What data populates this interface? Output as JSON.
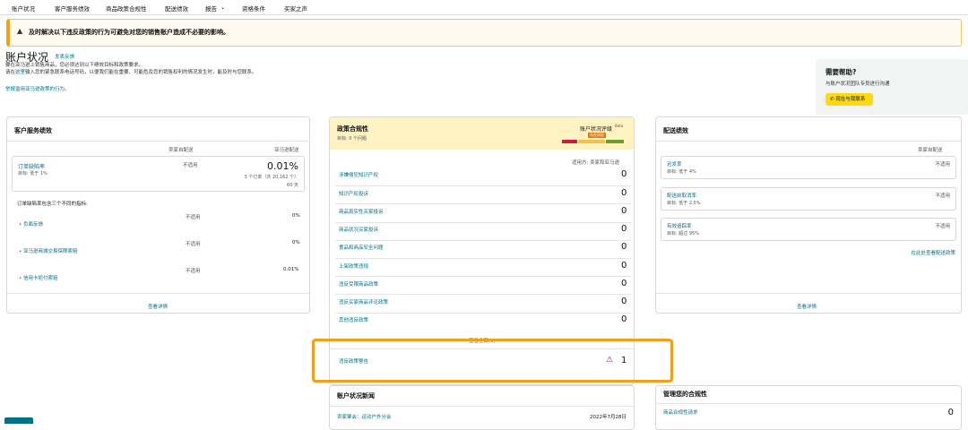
{
  "nav": {
    "items": [
      "账户状况",
      "客户服务绩效",
      "商品政策合规性",
      "配送绩效",
      "报告",
      "资格条件",
      "买家之声"
    ],
    "report_arrow": "⌄"
  },
  "banner": {
    "text": "及时解决以下违反政策的行为可避免对您的销售账户造成不必要的影响。"
  },
  "header": {
    "title": "账户状况",
    "feedback": "发表反馈",
    "intro_line1": "要在亚马逊上销售商品，您必须达到以下绩效目标和政策要求。",
    "intro_line2_pre": "请在",
    "intro_line2_link": "这里",
    "intro_line2_post": "输入您的紧急联系电话号码，以便我们能在重要、可能危及您的销售权利的情况发生时，能及时与您联系。",
    "policy_link": "举报滥用亚马逊政策的行为。"
  },
  "help": {
    "title": "需要帮助?",
    "subtitle": "与账户状况团队专员进行沟通",
    "button": "现在与我联系"
  },
  "customer_service": {
    "title": "客户服务绩效",
    "col1": "卖家自配送",
    "col2": "亚马逊配送",
    "odr_label": "订单缺陷率",
    "odr_target": "目标: 低于 1%",
    "odr_seller": "不适用",
    "odr_value": "0.01%",
    "odr_detail1": "3 个订单（共 20,162 个）",
    "odr_detail2": "60 天",
    "metrics_intro": "订单缺陷率包含三个不同的指标:",
    "metrics": [
      {
        "label": "负面反馈",
        "seller": "不适用",
        "fba": "0%"
      },
      {
        "label": "亚马逊商城交易保障索赔",
        "seller": "不适用",
        "fba": "0%"
      },
      {
        "label": "信用卡拒付索赔",
        "seller": "不适用",
        "fba": "0.01%"
      }
    ],
    "details": "查看详情"
  },
  "policy": {
    "title": "政策合规性",
    "target": "目标: 0 个问题",
    "status_label": "账户状况评级",
    "status_new": "Beta",
    "status_badge": "存在风险",
    "applies": "适用方: 卖家和亚马逊",
    "rows": [
      {
        "label": "涉嫌侵犯知识产权",
        "value": "0"
      },
      {
        "label": "知识产权投诉",
        "value": "0"
      },
      {
        "label": "商品真实性买家投诉",
        "value": "0"
      },
      {
        "label": "商品状况买家投诉",
        "value": "0"
      },
      {
        "label": "食品和商品安全问题",
        "value": "0"
      },
      {
        "label": "上架政策违规",
        "value": "0"
      },
      {
        "label": "违反受限商品政策",
        "value": "0"
      },
      {
        "label": "违反买家商品评论政策",
        "value": "0"
      },
      {
        "label": "其他违反政策",
        "value": "0"
      }
    ],
    "view_all": "查看全部(0)",
    "warning_label": "违反政策警告",
    "warning_value": "1"
  },
  "delivery": {
    "title": "配送绩效",
    "col": "卖家自配送",
    "rows": [
      {
        "label": "迟发率",
        "target": "目标: 低于 4%",
        "value": "不适用"
      },
      {
        "label": "配送前取消率",
        "target": "目标: 低于 2.5%",
        "value": "不适用"
      },
      {
        "label": "有效追踪率",
        "target": "目标: 超过 95%",
        "value": "不适用"
      }
    ],
    "policy_link": "在此处查看配送政策",
    "details": "查看详情"
  },
  "news": {
    "title": "账户状况新闻",
    "item_label": "卖家聚会：运动户外分会",
    "item_date": "2022年7月28日"
  },
  "manage": {
    "title": "管理您的合规性",
    "item_label": "商品合规性请求",
    "item_value": "0"
  },
  "colors": {
    "accent": "#f0a01c",
    "link": "#007185",
    "help_button": "#ffd814"
  }
}
